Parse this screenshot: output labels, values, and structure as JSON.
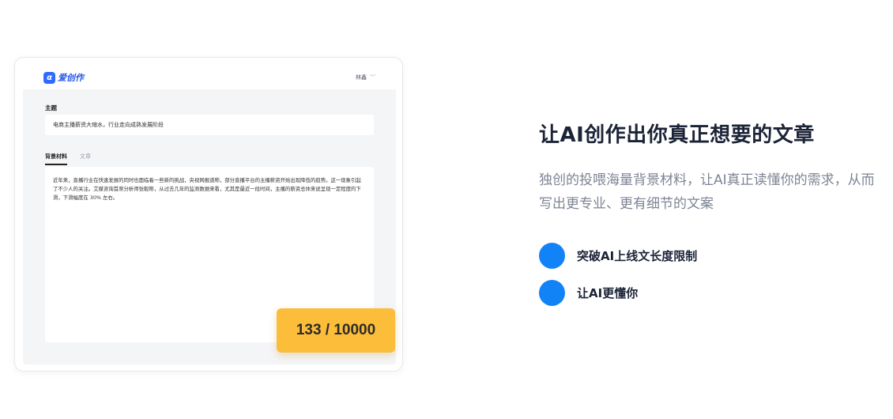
{
  "app": {
    "logo_mark": "α",
    "logo_text": "爱创作",
    "user_name": "林鑫"
  },
  "editor": {
    "topic_label": "主题",
    "topic_value": "电商主播薪资大缩水，行业走向成熟发展阶段",
    "tabs": [
      "背景材料",
      "文章"
    ],
    "material_text": "近年来，直播行业在快速发展的同时也面临着一些新的挑战，央视网报道称，部分直播平台的主播薪资开始出现降低的趋势。这一现象引起了不少人的关注。艾媒咨询首席分析师张毅称，从过去几年的监测数据来看，尤其是最近一段时间，主播的薪资总体来说呈现一定程度的下滑，下滑幅度在 30% 左右。",
    "counter": "133 / 10000"
  },
  "hero": {
    "title": "让AI创作出你真正想要的文章",
    "description": "独创的投喂海量背景材料，让AI真正读懂你的需求，从而写出更专业、更有细节的文案",
    "features": [
      "突破AI上线文长度限制",
      "让AI更懂你"
    ]
  },
  "colors": {
    "accent_blue": "#1283f7",
    "counter_yellow": "#fbbd3a"
  }
}
